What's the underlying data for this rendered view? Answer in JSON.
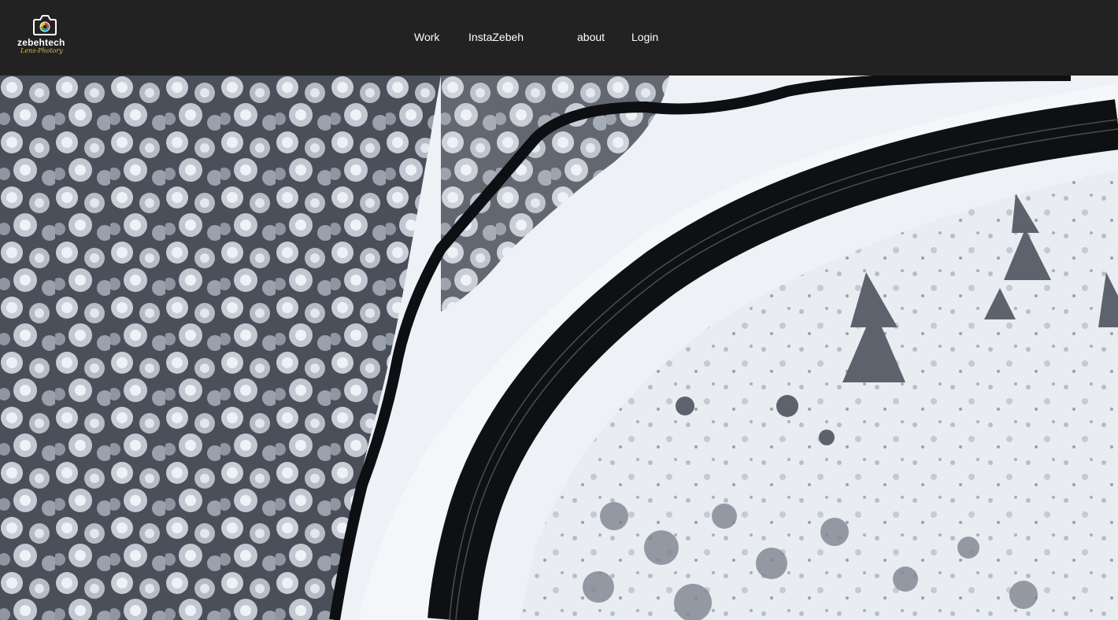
{
  "brand": {
    "name": "zebehtech",
    "tagline": "Lens-Photory",
    "icon": "camera-icon",
    "colors": {
      "tagline": "#d8b948",
      "header_bg": "#222222"
    }
  },
  "nav": {
    "items": [
      {
        "label": "Work"
      },
      {
        "label": "InstaZebeh"
      },
      {
        "label": "about"
      },
      {
        "label": "Login"
      }
    ]
  },
  "hero": {
    "image": "aerial-winter-road-photo"
  }
}
